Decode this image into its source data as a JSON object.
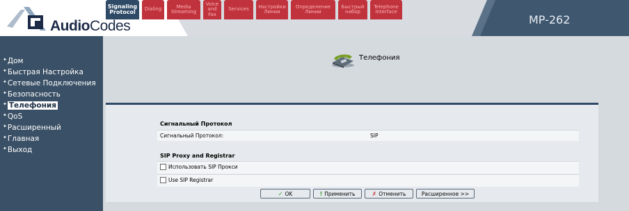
{
  "header": {
    "logo_text_bold": "Audio",
    "logo_text_rest": "Codes",
    "product": "MP-262"
  },
  "sidebar": {
    "items": [
      {
        "label": "Дом",
        "active": false
      },
      {
        "label": "Быстрая Настройка",
        "active": false
      },
      {
        "label": "Сетевые Подключения",
        "active": false
      },
      {
        "label": "Безопасность",
        "active": false
      },
      {
        "label": "Телефония",
        "active": true
      },
      {
        "label": "QoS",
        "active": false
      },
      {
        "label": "Расширенный",
        "active": false
      },
      {
        "label": "Главная",
        "active": false
      },
      {
        "label": "Выход",
        "active": false
      }
    ]
  },
  "page": {
    "title": "Телефония",
    "icon": "telephone-icon"
  },
  "tabs": [
    {
      "label": "Signaling Protocol",
      "lines": [
        "Signaling",
        "Protocol"
      ],
      "active": true
    },
    {
      "label": "Dialing",
      "lines": [
        "Dialing"
      ],
      "active": false
    },
    {
      "label": "Media Streaming",
      "lines": [
        "Media",
        "Streaming"
      ],
      "active": false
    },
    {
      "label": "Voice and Fax",
      "lines": [
        "Voice",
        "and",
        "Fax"
      ],
      "active": false
    },
    {
      "label": "Services",
      "lines": [
        "Services"
      ],
      "active": false
    },
    {
      "label": "Настройки Линии",
      "lines": [
        "Настройки",
        "Линии"
      ],
      "active": false
    },
    {
      "label": "Определение Линии",
      "lines": [
        "Определение",
        "Линии"
      ],
      "active": false
    },
    {
      "label": "Быстрый набор",
      "lines": [
        "Быстрый",
        "набор"
      ],
      "active": false
    },
    {
      "label": "Telephone Interface",
      "lines": [
        "Telephone",
        "Interface"
      ],
      "active": false
    }
  ],
  "content": {
    "section1_title": "Сигнальный Протокол",
    "protocol_label": "Сигнальный Протокол:",
    "protocol_value": "SIP",
    "section2_title": "SIP Proxy and Registrar",
    "use_proxy_label": "Использовать SIP Прокси",
    "use_proxy_checked": false,
    "use_registrar_label": "Use SIP Registrar",
    "use_registrar_checked": false
  },
  "buttons": {
    "ok": "OK",
    "apply": "Применить",
    "cancel": "Отменить",
    "advanced": "Расширенное >>"
  },
  "colors": {
    "sidebar_bg": "#3a5066",
    "tab_inactive": "#c0333d",
    "tab_active": "#2e4a67",
    "main_bg": "#d5dadf"
  }
}
